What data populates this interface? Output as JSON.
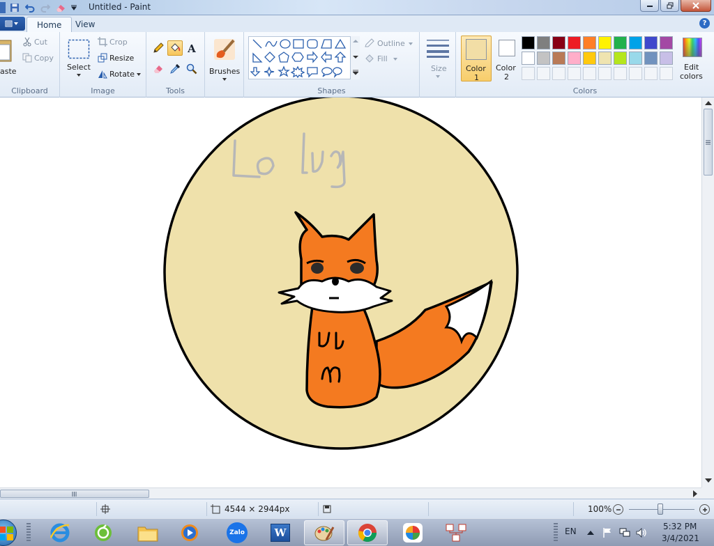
{
  "window": {
    "title": "Untitled - Paint"
  },
  "tabs": [
    {
      "label": "Home"
    },
    {
      "label": "View"
    }
  ],
  "ribbon": {
    "clipboard": {
      "label": "Clipboard",
      "paste": "aste",
      "cut": "Cut",
      "copy": "Copy"
    },
    "image": {
      "label": "Image",
      "select": "Select",
      "crop": "Crop",
      "resize": "Resize",
      "rotate": "Rotate"
    },
    "tools": {
      "label": "Tools"
    },
    "brushes": {
      "label": "Brushes"
    },
    "shapes": {
      "label": "Shapes",
      "outline": "Outline",
      "fill": "Fill"
    },
    "size": {
      "label": "Size"
    },
    "colors": {
      "label": "Colors",
      "color1_label": "Color",
      "color1_num": "1",
      "color2_label": "Color",
      "color2_num": "2",
      "edit1": "Edit",
      "edit2": "colors",
      "color1_value": "#f2dea6",
      "color2_value": "#ffffff",
      "palette_row1": [
        "#000000",
        "#7f7f7f",
        "#880015",
        "#ed1c24",
        "#ff7f27",
        "#fff200",
        "#22b14c",
        "#00a2e8",
        "#3f48cc",
        "#a349a4"
      ],
      "palette_row2": [
        "#ffffff",
        "#c3c3c3",
        "#b97a57",
        "#ffaec9",
        "#ffc90e",
        "#efe4b0",
        "#b5e61d",
        "#99d9ea",
        "#7092be",
        "#c8bfe7"
      ]
    }
  },
  "canvas": {
    "drawing_text": "Lo ly",
    "circle_fill": "#efe1ab",
    "fox_color": "#f47a20"
  },
  "status": {
    "dimensions": "4544 × 2944px",
    "zoom": "100%"
  },
  "taskbar": {
    "apps": [
      "ie-icon",
      "greenapp-icon",
      "explorer-icon",
      "media-player-icon",
      "zalo-icon",
      "word-icon",
      "paint-icon",
      "chrome-icon",
      "color-app-icon",
      "network-app-icon"
    ],
    "zalo_label": "Zalo",
    "word_label": "W",
    "lang": "EN",
    "time": "5:32 PM",
    "date": "3/4/2021"
  }
}
